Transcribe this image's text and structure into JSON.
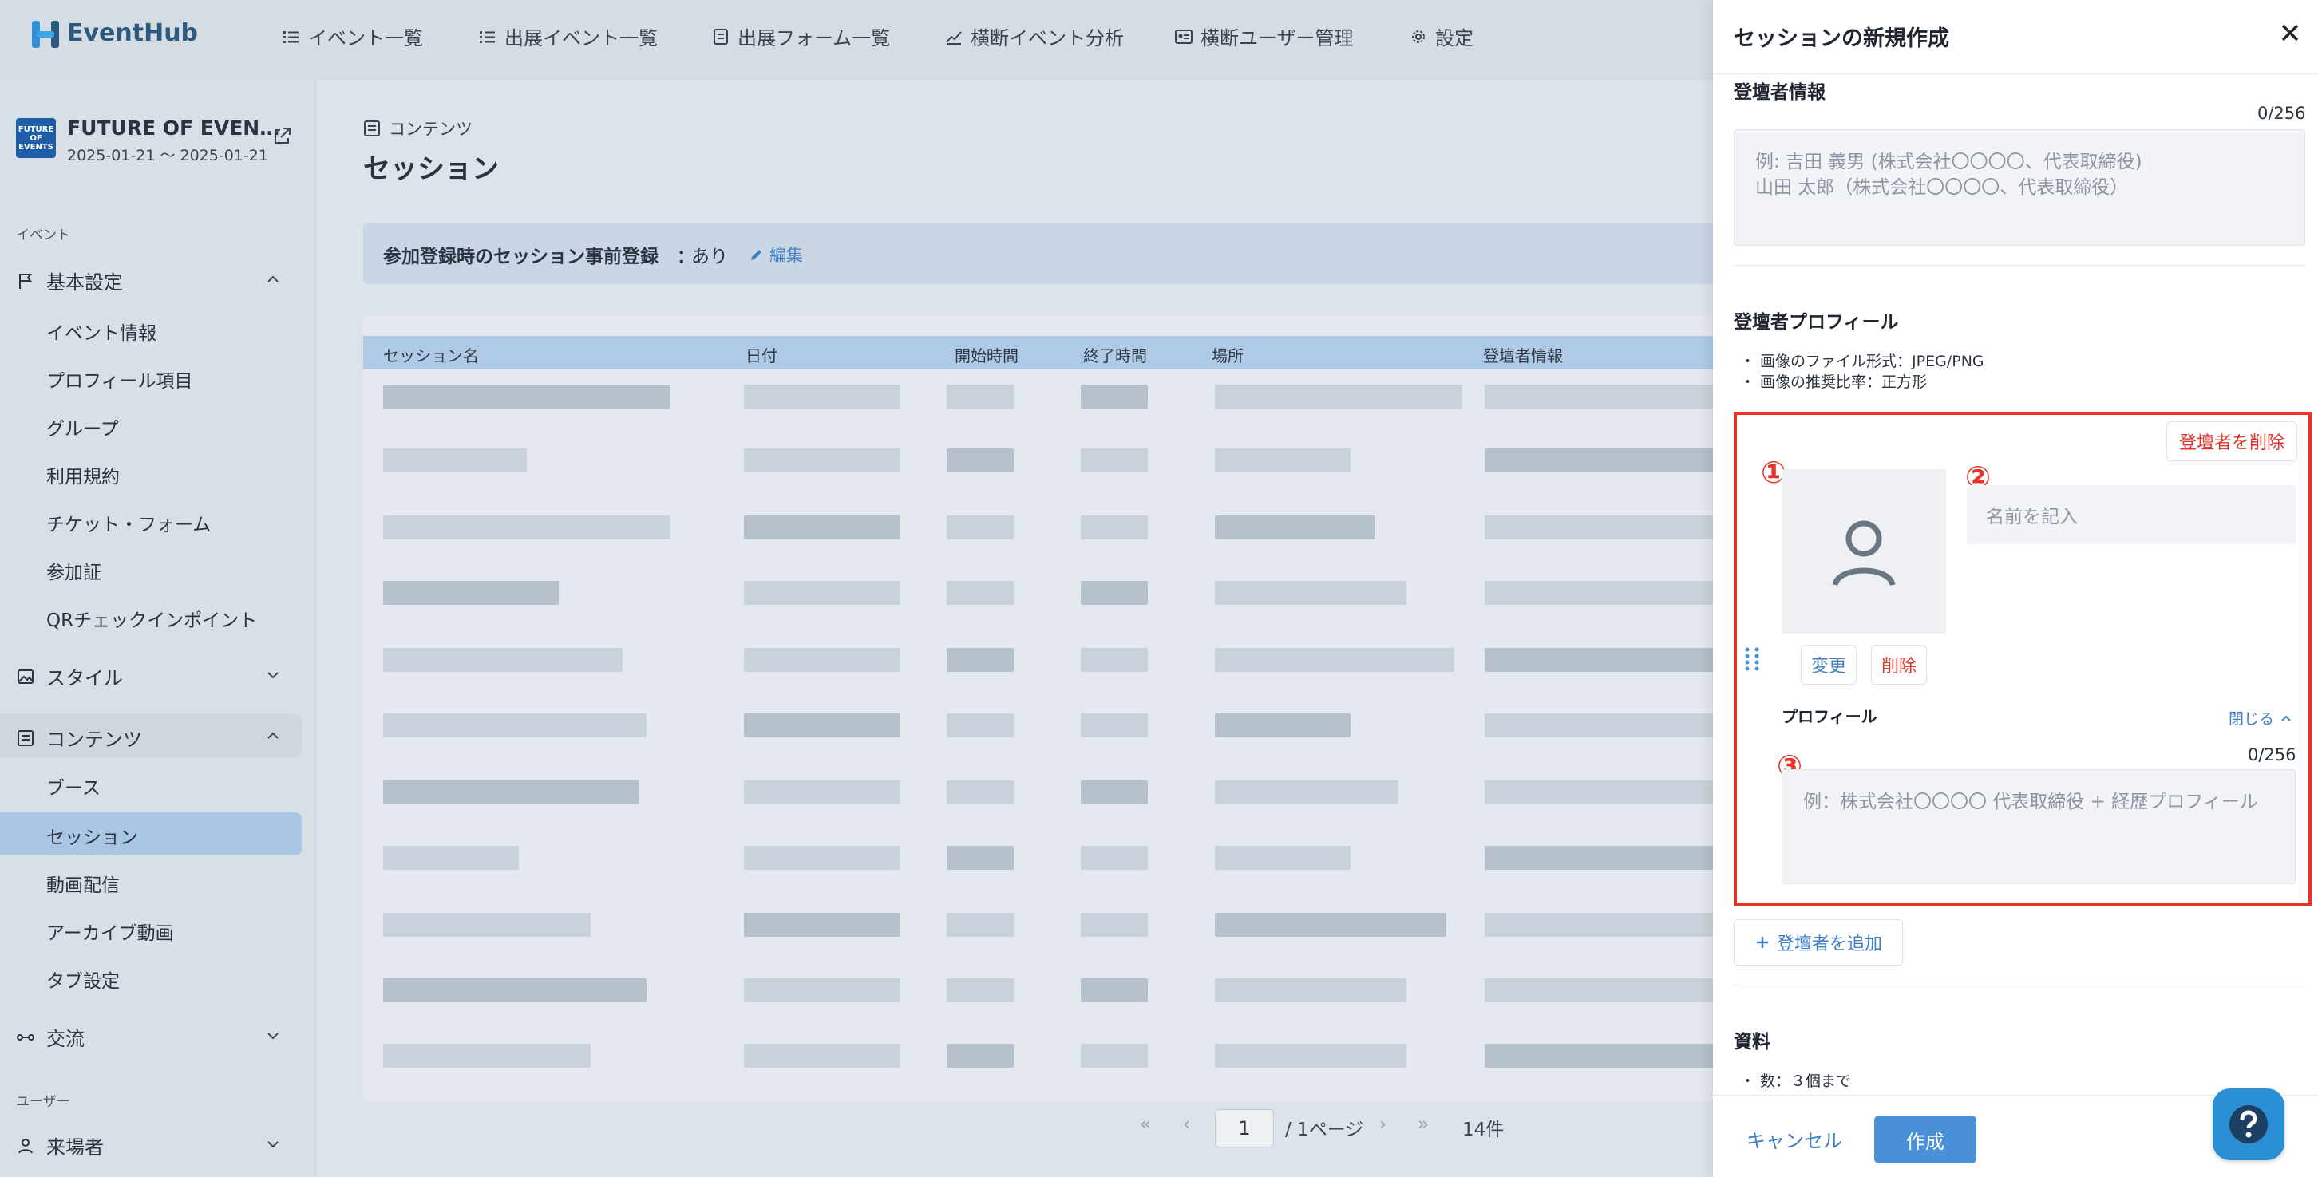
{
  "app": {
    "name": "EventHub"
  },
  "header": {
    "nav": [
      {
        "label": "イベント一覧",
        "icon": "list-icon"
      },
      {
        "label": "出展イベント一覧",
        "icon": "list-icon"
      },
      {
        "label": "出展フォーム一覧",
        "icon": "form-icon"
      },
      {
        "label": "横断イベント分析",
        "icon": "chart-icon"
      },
      {
        "label": "横断ユーザー管理",
        "icon": "id-card-icon"
      },
      {
        "label": "設定",
        "icon": "gear-icon"
      }
    ]
  },
  "event": {
    "name": "FUTURE OF EVEN…",
    "dates": "2025-01-21 ～ 2025-01-21",
    "thumb_text": "FUTURE OF EVENTS"
  },
  "sidebar": {
    "section_event": "イベント",
    "basic": {
      "label": "基本設定",
      "items": [
        "イベント情報",
        "プロフィール項目",
        "グループ",
        "利用規約",
        "チケット・フォーム",
        "参加証",
        "QRチェックインポイント"
      ]
    },
    "style": {
      "label": "スタイル"
    },
    "contents": {
      "label": "コンテンツ",
      "items": [
        "ブース",
        "セッション",
        "動画配信",
        "アーカイブ動画",
        "タブ設定"
      ]
    },
    "exchange": {
      "label": "交流"
    },
    "section_user": "ユーザー",
    "visitors": {
      "label": "来場者"
    }
  },
  "main": {
    "breadcrumb": "コンテンツ",
    "title": "セッション",
    "prereg_label": "参加登録時のセッション事前登録　：",
    "prereg_value": "あり",
    "edit_label": "編集",
    "table": {
      "headers": [
        "セッション名",
        "日付",
        "開始時間",
        "終了時間",
        "場所",
        "登壇者情報"
      ]
    },
    "pager": {
      "page": "1",
      "total_pages": "/ 1ページ",
      "count": "14件",
      "first": "«",
      "prev": "‹",
      "next": "›",
      "last": "»"
    }
  },
  "drawer": {
    "title": "セッションの新規作成",
    "speaker_info": {
      "label": "登壇者情報",
      "count": "0/256",
      "placeholder": "例: 吉田 義男 (株式会社〇〇〇〇、代表取締役)\n山田 太郎（株式会社〇〇〇〇、代表取締役）"
    },
    "speaker_profile": {
      "label": "登壇者プロフィール",
      "notes": [
        "画像のファイル形式：JPEG/PNG",
        "画像の推奨比率：正方形"
      ],
      "delete_speaker": "登壇者を削除",
      "change": "変更",
      "delete": "削除",
      "name_placeholder": "名前を記入",
      "profile_label": "プロフィール",
      "collapse": "閉じる",
      "profile_count": "0/256",
      "profile_placeholder": "例：株式会社〇〇〇〇 代表取締役 + 経歴プロフィール",
      "badges": [
        "①",
        "②",
        "③"
      ]
    },
    "add_speaker": "登壇者を追加",
    "materials": {
      "label": "資料",
      "note": "数：３個まで"
    },
    "footer": {
      "cancel": "キャンセル",
      "create": "作成"
    }
  },
  "colors": {
    "accent": "#4a90d9",
    "highlight": "#e83428",
    "brand": "#2c5a7e"
  }
}
